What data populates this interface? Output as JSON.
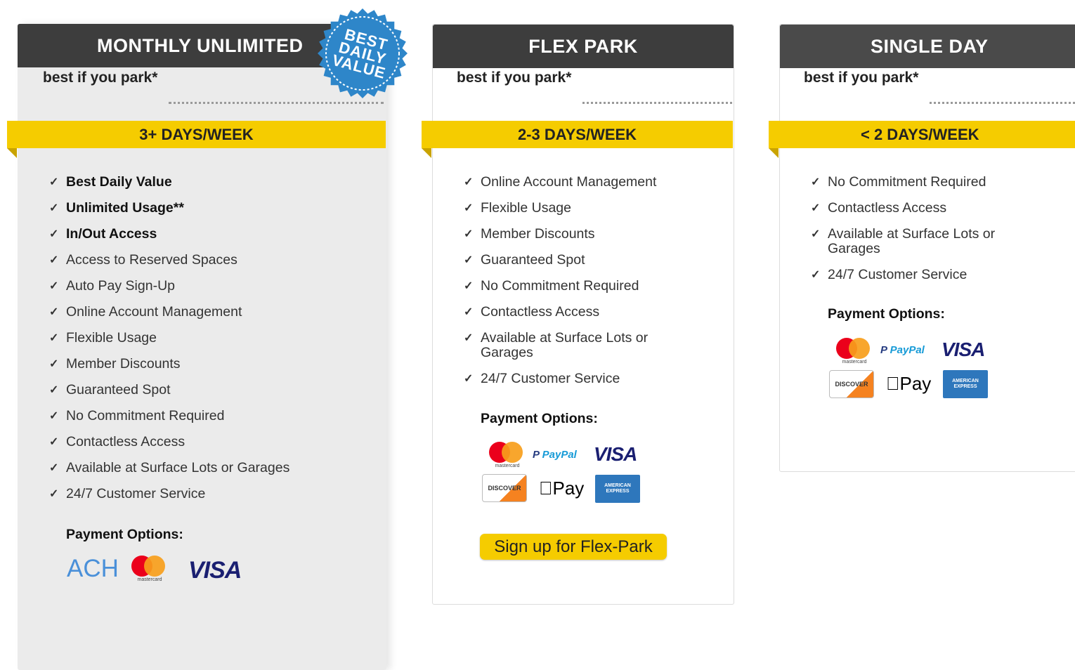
{
  "colors": {
    "header_bg": "#3d3d3d",
    "band": "#f5cc00",
    "badge": "#2e86c9",
    "featured_bg": "#ebebeb"
  },
  "plans": [
    {
      "title": "MONTHLY UNLIMITED",
      "badge": [
        "BEST",
        "DAILY",
        "VALUE"
      ],
      "best_if": "best if you park*",
      "frequency": "3+ DAYS/WEEK",
      "features": [
        {
          "text": "Best Daily Value",
          "bold": true
        },
        {
          "text": "Unlimited Usage**",
          "bold": true
        },
        {
          "text": "In/Out Access",
          "bold": true
        },
        {
          "text": "Access to Reserved Spaces"
        },
        {
          "text": "Auto Pay Sign-Up"
        },
        {
          "text": "Online Account Management"
        },
        {
          "text": "Flexible Usage"
        },
        {
          "text": "Member Discounts"
        },
        {
          "text": "Guaranteed Spot"
        },
        {
          "text": "No Commitment Required"
        },
        {
          "text": "Contactless Access"
        },
        {
          "text": "Available at Surface Lots or Garages"
        },
        {
          "text": "24/7 Customer Service"
        }
      ],
      "payment_title": "Payment Options:",
      "payment_icons": [
        "ach-logo",
        "mastercard-logo",
        "visa-logo"
      ]
    },
    {
      "title": "FLEX PARK",
      "best_if": "best if you park*",
      "frequency": "2-3 DAYS/WEEK",
      "features": [
        {
          "text": "Online Account Management"
        },
        {
          "text": "Flexible Usage"
        },
        {
          "text": "Member Discounts"
        },
        {
          "text": "Guaranteed Spot"
        },
        {
          "text": "No Commitment Required"
        },
        {
          "text": "Contactless Access"
        },
        {
          "text": "Available at Surface Lots or Garages"
        },
        {
          "text": "24/7 Customer Service"
        }
      ],
      "payment_title": "Payment Options:",
      "payment_icons": [
        "mastercard-logo",
        "paypal-logo",
        "visa-logo",
        "discover-logo",
        "apple-pay-logo",
        "amex-logo"
      ],
      "cta": "Sign up for Flex-Park"
    },
    {
      "title": "SINGLE DAY",
      "best_if": "best if you park*",
      "frequency": "< 2 DAYS/WEEK",
      "features": [
        {
          "text": "No Commitment Required"
        },
        {
          "text": "Contactless Access"
        },
        {
          "text": "Available at Surface Lots or Garages"
        },
        {
          "text": "24/7 Customer Service"
        }
      ],
      "payment_title": "Payment Options:",
      "payment_icons": [
        "mastercard-logo",
        "paypal-logo",
        "visa-logo",
        "discover-logo",
        "apple-pay-logo",
        "amex-logo"
      ]
    }
  ],
  "logos": {
    "ach": "ACH",
    "mastercard": "mastercard",
    "visa": "VISA",
    "paypal_a": "PayPal",
    "discover": "DISCOVER",
    "apple_pay": "Pay",
    "amex": "AMERICAN EXPRESS"
  }
}
